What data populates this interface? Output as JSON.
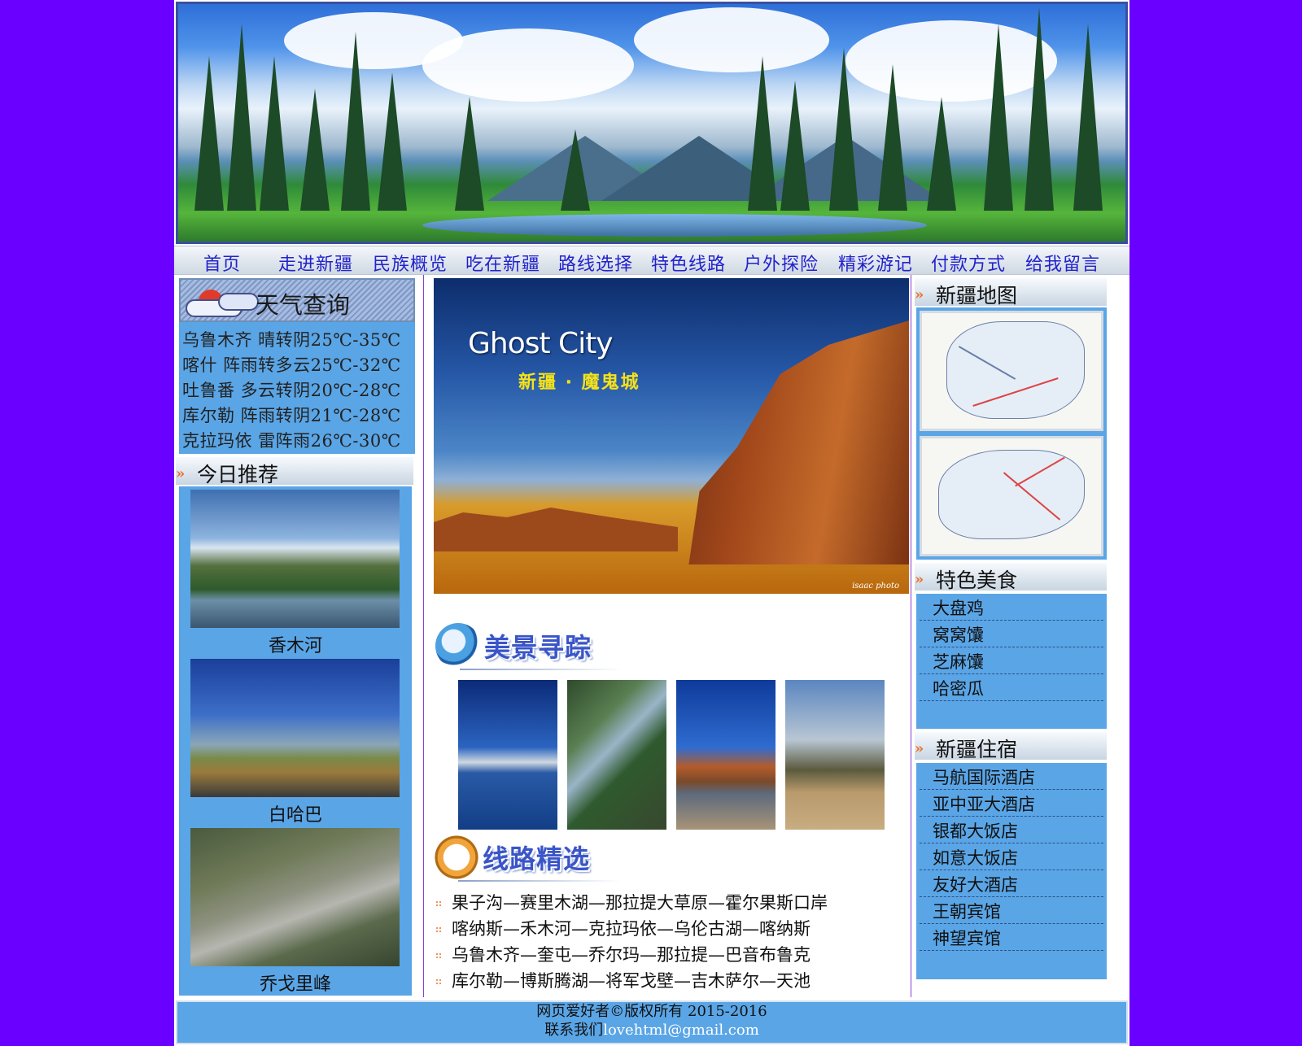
{
  "nav": {
    "items": [
      "首页",
      "走进新疆",
      "民族概览",
      "吃在新疆",
      "路线选择",
      "特色线路",
      "户外探险",
      "精彩游记",
      "付款方式",
      "给我留言"
    ]
  },
  "weather": {
    "title": "天气查询",
    "rows": [
      "乌鲁木齐 晴转阴25℃-35℃",
      "喀什 阵雨转多云25℃-32℃",
      "吐鲁番 多云转阴20℃-28℃",
      "库尔勒 阵雨转阴21℃-28℃",
      "克拉玛依 雷阵雨26℃-30℃"
    ]
  },
  "recommend": {
    "title": "今日推荐",
    "items": [
      {
        "label": "香木河"
      },
      {
        "label": "白哈巴"
      },
      {
        "label": "乔戈里峰"
      }
    ]
  },
  "hero": {
    "title": "Ghost City",
    "subtitle": "新疆 · 魔鬼城",
    "credit": "isaac photo"
  },
  "scenery": {
    "title": "美景寻踪"
  },
  "routes": {
    "title": "线路精选",
    "items": [
      "果子沟—赛里木湖—那拉提大草原—霍尔果斯口岸",
      "喀纳斯—禾木河—克拉玛依—乌伦古湖—喀纳斯",
      "乌鲁木齐—奎屯—乔尔玛—那拉提—巴音布鲁克",
      "库尔勒—博斯腾湖—将军戈壁—吉木萨尔—天池"
    ]
  },
  "map_section": {
    "title": "新疆地图"
  },
  "food": {
    "title": "特色美食",
    "items": [
      "大盘鸡",
      "窝窝馕",
      "芝麻馕",
      "哈密瓜"
    ]
  },
  "hotels": {
    "title": "新疆住宿",
    "items": [
      "马航国际酒店",
      "亚中亚大酒店",
      "银都大饭店",
      "如意大饭店",
      "友好大酒店",
      "王朝宾馆",
      "神望宾馆"
    ]
  },
  "footer": {
    "line1": "网页爱好者©版权所有 2015-2016",
    "contact_prefix": "联系我们",
    "email": "lovehtml@gmail.com"
  },
  "colors": {
    "page_background": "#6a00ff",
    "panel_blue": "#5aa5e6",
    "nav_text": "#2222cc",
    "accent_arrow": "#e8702a"
  },
  "icons": [
    "weather-cloud-icon",
    "magnifier-icon",
    "compass-icon",
    "section-arrow-icon"
  ]
}
